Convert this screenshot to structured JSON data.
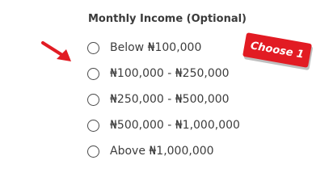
{
  "question": {
    "label": "Monthly Income (Optional)"
  },
  "options": [
    {
      "label": "Below ₦100,000",
      "selected": false
    },
    {
      "label": "₦100,000 - ₦250,000",
      "selected": false
    },
    {
      "label": "₦250,000 - ₦500,000",
      "selected": false
    },
    {
      "label": "₦500,000 - ₦1,000,000",
      "selected": false
    },
    {
      "label": "Above ₦1,000,000",
      "selected": false
    }
  ],
  "annotation": {
    "badge_text": "Choose 1",
    "arrow_icon": "arrow-pointer-icon",
    "accent_color": "#e21b23"
  }
}
